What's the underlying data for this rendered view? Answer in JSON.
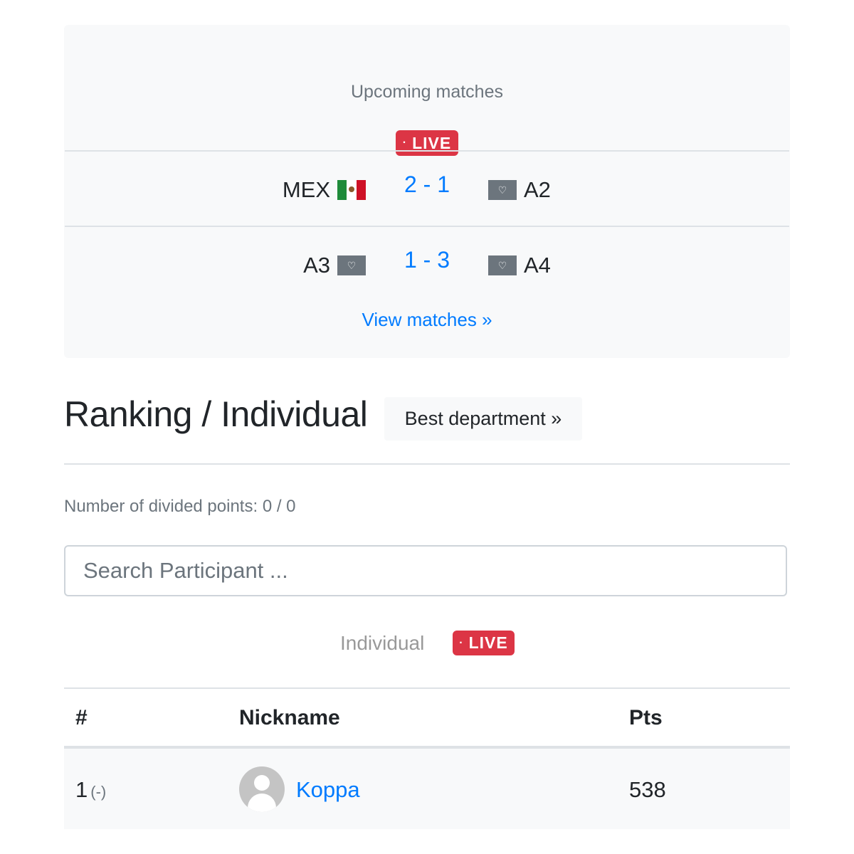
{
  "upcoming": {
    "title": "Upcoming matches",
    "live_label": "LIVE",
    "live_dot": "·",
    "matches": [
      {
        "home": "MEX",
        "home_flag": "mexico-flag-icon",
        "score": "2 - 1",
        "away": "A2",
        "away_flag": "placeholder-flag-icon"
      },
      {
        "home": "A3",
        "home_flag": "placeholder-flag-icon",
        "score": "1 - 3",
        "away": "A4",
        "away_flag": "placeholder-flag-icon"
      }
    ],
    "view_matches": "View matches »"
  },
  "ranking": {
    "title": "Ranking / Individual",
    "best_department": "Best department »",
    "divided_points": "Number of divided points: 0 / 0",
    "search_placeholder": "Search Participant ...",
    "tab_label": "Individual",
    "live_label": "LIVE",
    "live_dot": "·"
  },
  "table": {
    "headers": {
      "rank": "#",
      "nickname": "Nickname",
      "pts": "Pts"
    },
    "rows": [
      {
        "rank": "1",
        "change": "(-)",
        "nickname": "Koppa",
        "pts": "538"
      }
    ]
  },
  "colors": {
    "live": "#dc3545",
    "link": "#007bff",
    "muted": "#6c757d"
  }
}
